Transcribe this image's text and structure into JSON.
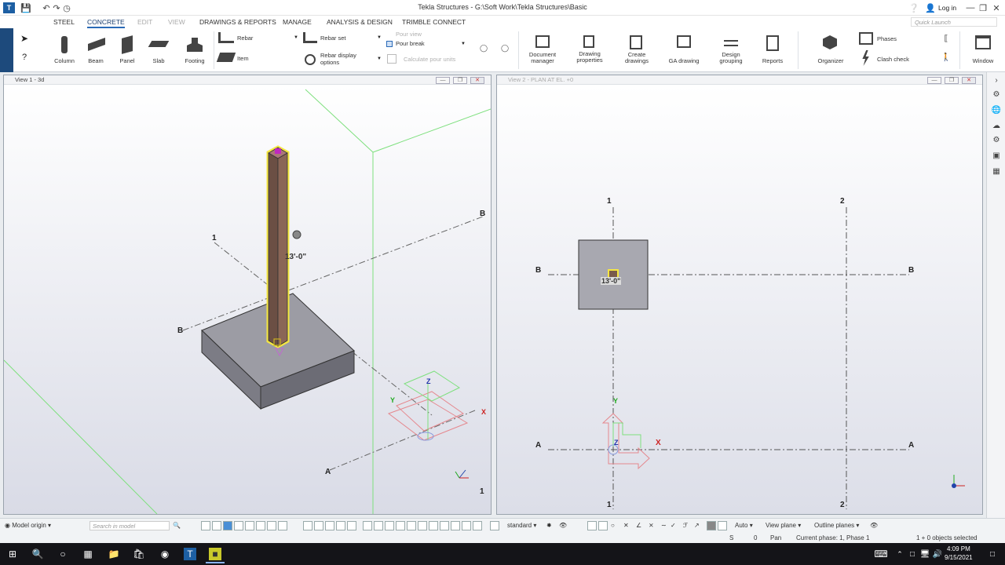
{
  "window": {
    "title": "Tekla Structures - G:\\Soft Work\\Tekla Structures\\Basic",
    "login": "Log in"
  },
  "menu": {
    "tabs": [
      "STEEL",
      "CONCRETE",
      "EDIT",
      "VIEW",
      "DRAWINGS & REPORTS",
      "MANAGE",
      "ANALYSIS & DESIGN",
      "TRIMBLE CONNECT"
    ],
    "active": "CONCRETE",
    "quick_launch_placeholder": "Quick Launch"
  },
  "ribbon": {
    "column": "Column",
    "beam": "Beam",
    "panel": "Panel",
    "slab": "Slab",
    "footing": "Footing",
    "rebar": "Rebar",
    "item": "Item",
    "rebar_set": "Rebar set",
    "rebar_display_options_1": "Rebar display",
    "rebar_display_options_2": "options",
    "pour_view": "Pour view",
    "pour_break": "Pour break",
    "calculate_pour_units": "Calculate pour units",
    "document_manager_1": "Document",
    "document_manager_2": "manager",
    "drawing_properties_1": "Drawing",
    "drawing_properties_2": "properties",
    "create_drawings_1": "Create",
    "create_drawings_2": "drawings",
    "ga_drawing": "GA drawing",
    "design_grouping_1": "Design",
    "design_grouping_2": "grouping",
    "reports": "Reports",
    "organizer": "Organizer",
    "phases": "Phases",
    "clash_check": "Clash check",
    "window": "Window"
  },
  "view1": {
    "title": "View 1 - 3d",
    "grid_1": "1",
    "grid_a": "A",
    "grid_b_left": "B",
    "grid_b_right": "B",
    "grid_1_bottom": "1",
    "dimension": "13'-0\"",
    "axis_x": "X",
    "axis_y": "Y",
    "axis_z": "Z"
  },
  "view2": {
    "title": "View 2 - PLAN AT EL. +0",
    "grid_1_top": "1",
    "grid_2_top": "2",
    "grid_1_bottom": "1",
    "grid_2_bottom": "2",
    "grid_a_left": "A",
    "grid_a_right": "A",
    "grid_b_left": "B",
    "grid_b_right": "B",
    "dimension": "13'-0\"",
    "axis_x": "X",
    "axis_y": "Y",
    "axis_z": "Z"
  },
  "bottom_toolbar": {
    "model_origin": "Model origin",
    "search_placeholder": "Search in model",
    "standard": "standard",
    "auto": "Auto",
    "view_plane": "View plane",
    "outline_planes": "Outline planes"
  },
  "status": {
    "s": "S",
    "zero": "0",
    "pan": "Pan",
    "current_phase": "Current phase: 1, Phase 1",
    "selected": "1 + 0 objects selected"
  },
  "taskbar": {
    "time": "4:09 PM",
    "date": "9/15/2021"
  },
  "colors": {
    "accent": "#2a6ab7",
    "ribbon_strip": "#1d4a7c",
    "column_fill": "#7a5a4a",
    "selection": "#f5e642",
    "grid": "#555555",
    "green_lines": "#66dd66"
  }
}
